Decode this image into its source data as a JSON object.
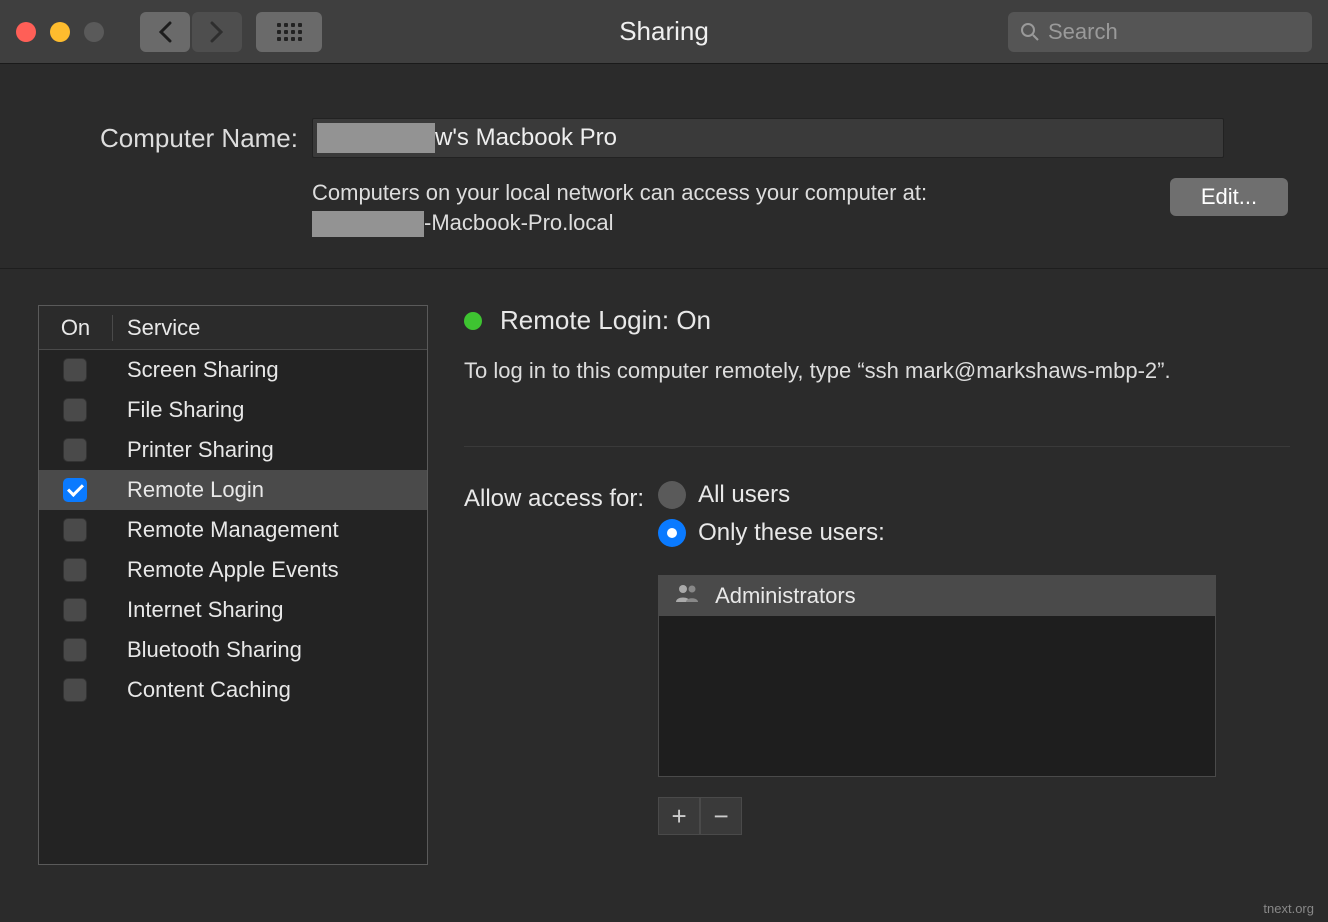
{
  "window": {
    "title": "Sharing"
  },
  "search": {
    "placeholder": "Search"
  },
  "computer_name": {
    "label": "Computer Name:",
    "value_suffix": "w's Macbook Pro",
    "sub_line1": "Computers on your local network can access your computer at:",
    "sub_line2_suffix": "-Macbook-Pro.local",
    "edit": "Edit..."
  },
  "service_table": {
    "col_on": "On",
    "col_service": "Service",
    "rows": [
      {
        "label": "Screen Sharing",
        "checked": false
      },
      {
        "label": "File Sharing",
        "checked": false
      },
      {
        "label": "Printer Sharing",
        "checked": false
      },
      {
        "label": "Remote Login",
        "checked": true
      },
      {
        "label": "Remote Management",
        "checked": false
      },
      {
        "label": "Remote Apple Events",
        "checked": false
      },
      {
        "label": "Internet Sharing",
        "checked": false
      },
      {
        "label": "Bluetooth Sharing",
        "checked": false
      },
      {
        "label": "Content Caching",
        "checked": false
      }
    ]
  },
  "detail": {
    "status_title": "Remote Login: On",
    "instruction": "To log in to this computer remotely, type “ssh mark@markshaws-mbp-2”.",
    "allow_label": "Allow access for:",
    "radio_all": "All users",
    "radio_only": "Only these users:",
    "users": [
      "Administrators"
    ]
  },
  "watermark": "tnext.org"
}
